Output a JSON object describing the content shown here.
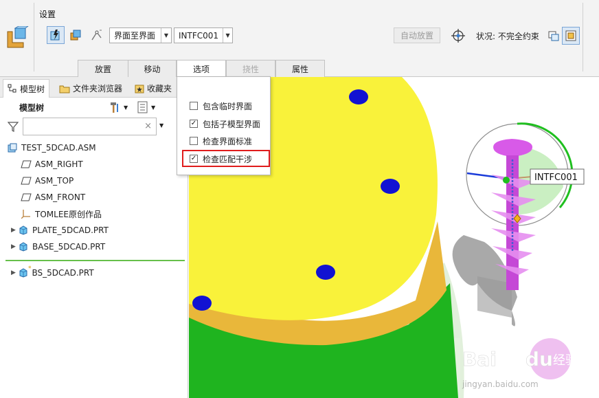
{
  "ribbon": {
    "group_title": "设置",
    "constraint_type": "界面至界面",
    "interface_name": "INTFC001",
    "auto_place_label": "自动放置",
    "status_text": "状况: 不完全约束",
    "tabs": [
      {
        "label": "放置"
      },
      {
        "label": "移动"
      },
      {
        "label": "选项"
      },
      {
        "label": "挠性"
      },
      {
        "label": "属性"
      }
    ]
  },
  "left_panel": {
    "tabs": [
      {
        "label": "模型树"
      },
      {
        "label": "文件夹浏览器"
      },
      {
        "label": "收藏夹"
      }
    ],
    "tree_title": "模型树",
    "filter_value": "",
    "tree": [
      {
        "label": "TEST_5DCAD.ASM",
        "icon": "assembly-icon"
      },
      {
        "label": "ASM_RIGHT",
        "icon": "datum-plane-icon"
      },
      {
        "label": "ASM_TOP",
        "icon": "datum-plane-icon"
      },
      {
        "label": "ASM_FRONT",
        "icon": "datum-plane-icon"
      },
      {
        "label": "TOMLEE原创作品",
        "icon": "coordinate-system-icon"
      },
      {
        "label": "PLATE_5DCAD.PRT",
        "icon": "part-icon"
      },
      {
        "label": "BASE_5DCAD.PRT",
        "icon": "part-icon"
      },
      {
        "label": "BS_5DCAD.PRT",
        "icon": "part-icon"
      }
    ]
  },
  "options_menu": {
    "items": [
      {
        "label": "包含临时界面",
        "checked": false
      },
      {
        "label": "包括子模型界面",
        "checked": true
      },
      {
        "label": "检查界面标准",
        "checked": false
      },
      {
        "label": "检查匹配干涉",
        "checked": true
      }
    ]
  },
  "viewport": {
    "interface_tag": "INTFC001",
    "watermark_url": "jingyan.baidu.com"
  },
  "colors": {
    "top_face": "#f9f23a",
    "side_orange": "#e9b73a",
    "side_green": "#1fb41f",
    "hole_blue": "#1212d2",
    "screw_magenta": "#d85ae8",
    "highlight_red": "#e01c1c"
  }
}
